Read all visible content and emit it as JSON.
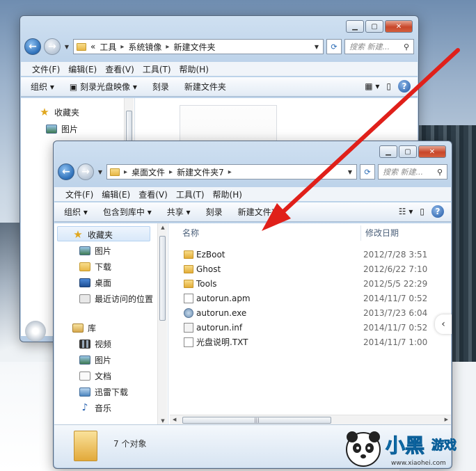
{
  "back_window": {
    "address": {
      "back_chevrons": "«",
      "crumbs": [
        "工具",
        "系统镜像",
        "新建文件夹"
      ]
    },
    "search_placeholder": "搜索 新建...",
    "menu": [
      "文件(F)",
      "编辑(E)",
      "查看(V)",
      "工具(T)",
      "帮助(H)"
    ],
    "toolbar": {
      "organize": "组织",
      "burn_image": "刻录光盘映像",
      "burn": "刻录",
      "new_folder": "新建文件夹"
    },
    "nav": {
      "favorites": "收藏夹",
      "pictures": "图片"
    }
  },
  "front_window": {
    "address": {
      "crumbs": [
        "桌面文件",
        "新建文件夹7"
      ]
    },
    "search_placeholder": "搜索 新建...",
    "menu": [
      "文件(F)",
      "编辑(E)",
      "查看(V)",
      "工具(T)",
      "帮助(H)"
    ],
    "toolbar": {
      "organize": "组织",
      "include_library": "包含到库中",
      "share": "共享",
      "burn": "刻录",
      "new_folder": "新建文件夹"
    },
    "nav": {
      "favorites": "收藏夹",
      "fav_items": [
        "图片",
        "下载",
        "桌面",
        "最近访问的位置"
      ],
      "library": "库",
      "lib_items": [
        "视频",
        "图片",
        "文档",
        "迅雷下载",
        "音乐"
      ]
    },
    "columns": {
      "name": "名称",
      "modified": "修改日期"
    },
    "files": [
      {
        "name": "EzBoot",
        "date": "2012/7/28 3:51",
        "type": "folder"
      },
      {
        "name": "Ghost",
        "date": "2012/6/22 7:10",
        "type": "folder"
      },
      {
        "name": "Tools",
        "date": "2012/5/5 22:29",
        "type": "folder"
      },
      {
        "name": "autorun.apm",
        "date": "2014/11/7 0:52",
        "type": "file"
      },
      {
        "name": "autorun.exe",
        "date": "2013/7/23 6:04",
        "type": "exe"
      },
      {
        "name": "autorun.inf",
        "date": "2014/11/7 0:52",
        "type": "inf"
      },
      {
        "name": "光盘说明.TXT",
        "date": "2014/11/7 1:00",
        "type": "file"
      }
    ],
    "status": "7 个对象"
  },
  "watermark": {
    "url": "www.xiaohei.com"
  },
  "colors": {
    "arrow": "#e0201a",
    "window_frame": "#bcd2e9",
    "accent": "#2d6fb8"
  }
}
